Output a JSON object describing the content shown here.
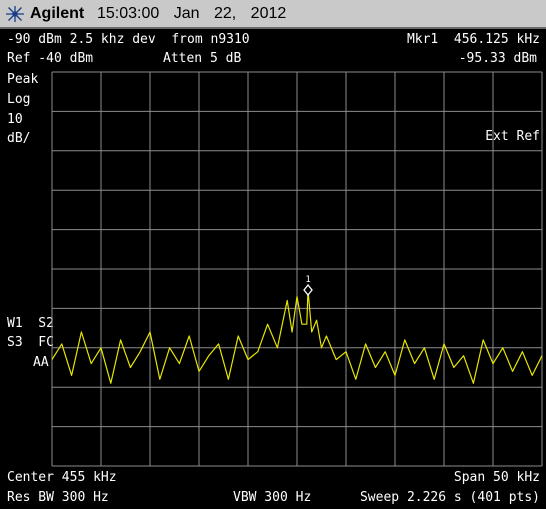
{
  "titlebar": {
    "brand": "Agilent",
    "time": "15:03:00",
    "date": "Jan 22, 2012"
  },
  "header": {
    "line1_left": "-90 dBm 2.5 khz dev  from n9310",
    "line1_right": "Mkr1  456.125 kHz",
    "ref": "Ref -40 dBm",
    "atten": "Atten 5 dB",
    "marker_amplitude": "-95.33 dBm"
  },
  "left_panel": {
    "peak": "Peak",
    "log": "Log",
    "scale_value": "10",
    "scale_unit": "dB/",
    "w1s2": "W1  S2",
    "s3fc": "S3  FC",
    "aa": "AA"
  },
  "ext_ref": "Ext Ref",
  "marker": {
    "label": "1",
    "freq_khz": 456.125,
    "amplitude_dbm": -95.33
  },
  "footer": {
    "center": "Center 455 kHz",
    "span": "Span 50 kHz",
    "res_bw": "Res BW 300 Hz",
    "vbw": "VBW 300 Hz",
    "sweep": "Sweep 2.226 s (401 pts)"
  },
  "chart_data": {
    "type": "line",
    "xlabel": "",
    "ylabel": "",
    "xlim": [
      430,
      480
    ],
    "ylim": [
      -140,
      -40
    ],
    "grid": true,
    "trace_color": "#e6e600",
    "grid_color": "#8c8c8c",
    "series": [
      {
        "x": [
          430,
          431,
          432,
          433,
          434,
          435,
          436,
          437,
          438,
          439,
          440,
          441,
          442,
          443,
          444,
          445,
          446,
          447,
          448,
          449,
          450,
          451,
          452,
          453,
          454,
          454.5,
          455,
          455.5,
          456,
          456.125,
          456.5,
          457,
          457.5,
          458,
          459,
          460,
          461,
          462,
          463,
          464,
          465,
          466,
          467,
          468,
          469,
          470,
          471,
          472,
          473,
          474,
          475,
          476,
          477,
          478,
          479,
          480
        ],
        "y": [
          -113,
          -109,
          -117,
          -106,
          -114,
          -110,
          -119,
          -108,
          -115,
          -111,
          -106,
          -118,
          -110,
          -114,
          -107,
          -116,
          -112,
          -109,
          -118,
          -107,
          -113,
          -111,
          -104,
          -110,
          -98,
          -106,
          -97,
          -104,
          -104,
          -95.3,
          -106,
          -103,
          -110,
          -107,
          -113,
          -111,
          -118,
          -109,
          -115,
          -111,
          -117,
          -108,
          -114,
          -110,
          -118,
          -109,
          -115,
          -112,
          -119,
          -108,
          -114,
          -110,
          -116,
          -111,
          -117,
          -112
        ]
      }
    ]
  }
}
